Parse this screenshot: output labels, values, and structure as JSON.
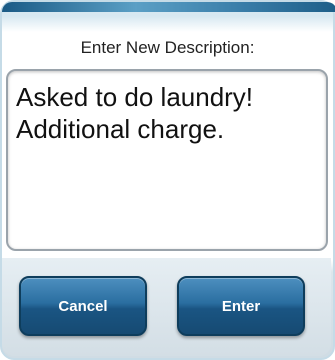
{
  "dialog": {
    "prompt": "Enter New Description:",
    "description_value": "Asked to do laundry!\nAdditional charge.",
    "cancel_label": "Cancel",
    "enter_label": "Enter"
  },
  "colors": {
    "button_top": "#4d8fbf",
    "button_bottom": "#164a72",
    "dialog_border": "#c5dbe7"
  }
}
